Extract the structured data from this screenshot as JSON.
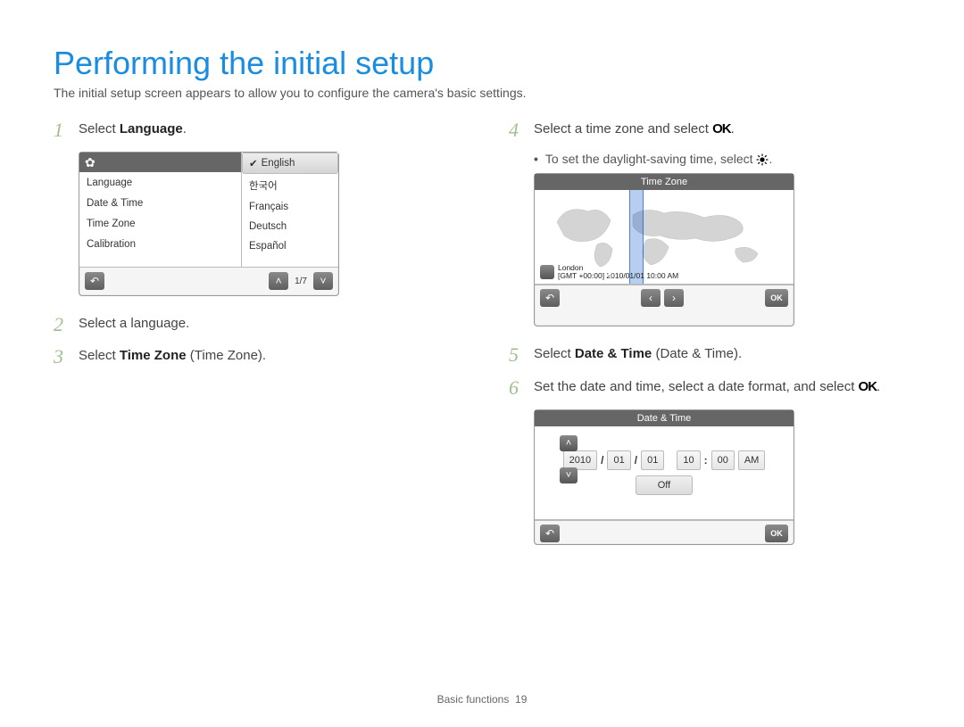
{
  "title": "Performing the initial setup",
  "intro": "The initial setup screen appears to allow you to configure the camera's basic settings.",
  "steps": {
    "s1_pre": "Select ",
    "s1_b": "Language",
    "s1_post": ".",
    "s2": "Select a language.",
    "s3_pre": "Select ",
    "s3_b": "Time Zone",
    "s3_post": " (Time Zone).",
    "s4_pre": "Select a time zone and select ",
    "s4_ok": "OK",
    "s4_post": ".",
    "s4_sub_pre": "To set the daylight-saving time, select ",
    "s4_sub_post": ".",
    "s5_pre": "Select ",
    "s5_b": "Date & Time",
    "s5_post": " (Date & Time).",
    "s6_pre": "Set the date and time, select a date format, and select ",
    "s6_ok": "OK",
    "s6_post": "."
  },
  "device1": {
    "menu": [
      "Language",
      "Date & Time",
      "Time Zone",
      "Calibration"
    ],
    "langs": [
      "English",
      "한국어",
      "Français",
      "Deutsch",
      "Español"
    ],
    "pager": "1/7"
  },
  "device2": {
    "head": "Time Zone",
    "city": "London",
    "gmt": "[GMT +00:00] 2010/01/01 10:00 AM",
    "ok": "OK"
  },
  "device3": {
    "head": "Date & Time",
    "year": "2010",
    "mon": "01",
    "day": "01",
    "hour": "10",
    "min": "00",
    "ampm": "AM",
    "off": "Off",
    "ok": "OK"
  },
  "footer_label": "Basic functions",
  "footer_page": "19"
}
